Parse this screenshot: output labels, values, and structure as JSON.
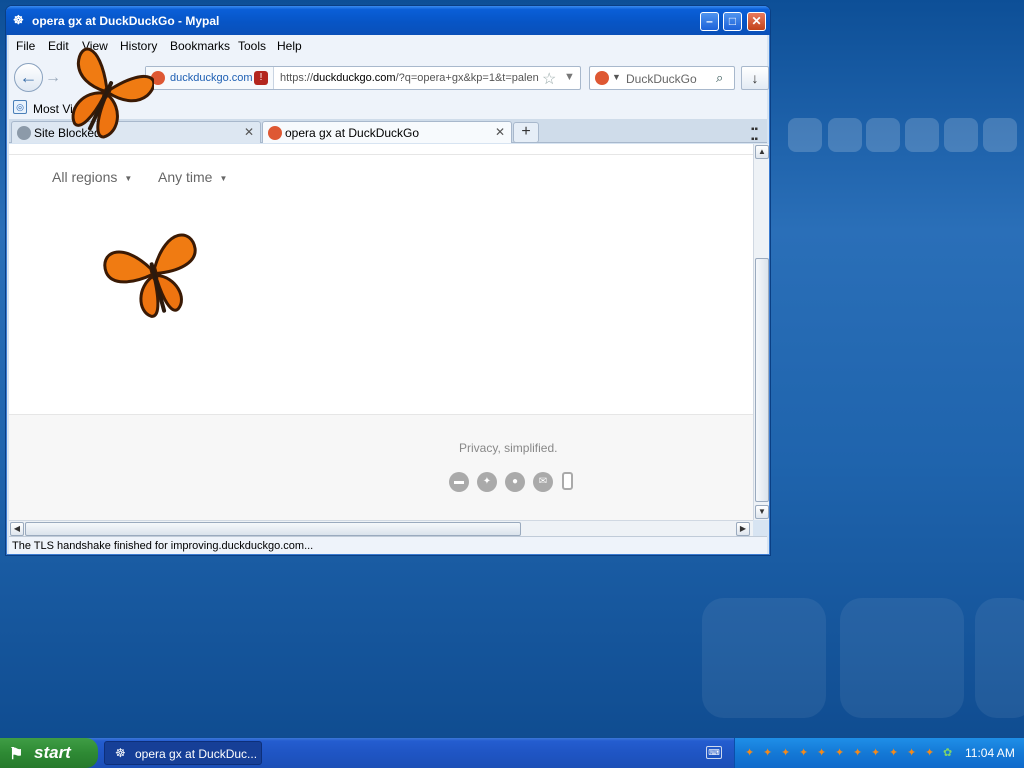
{
  "window": {
    "title": "opera gx at DuckDuckGo - Mypal",
    "controls": {
      "minimize": "–",
      "maximize": "□",
      "close": "✕"
    }
  },
  "menu": [
    "File",
    "Edit",
    "View",
    "History",
    "Bookmarks",
    "Tools",
    "Help"
  ],
  "navbar": {
    "identity_domain": "duckduckgo.com",
    "url_prefix": "https://",
    "url_host": "duckduckgo.com",
    "url_rest": "/?q=opera+gx&kp=1&t=palen",
    "search_engine": "DuckDuckGo"
  },
  "bookmarks": {
    "most_visited": "Most Visited"
  },
  "tabs": [
    {
      "label": "Site Blocked",
      "active": false
    },
    {
      "label": "opera gx at DuckDuckGo",
      "active": true
    }
  ],
  "page": {
    "filters": [
      "All regions",
      "Any time"
    ],
    "tagline": "Privacy, simplified.",
    "social_icons": [
      "chat-icon",
      "twitter-icon",
      "reddit-icon",
      "email-icon",
      "phone-icon"
    ]
  },
  "status": "The TLS handshake finished for improving.duckduckgo.com...",
  "taskbar": {
    "start": "start",
    "task_label": "opera gx at DuckDuc...",
    "clock": "11:04 AM"
  },
  "colors": {
    "accent": "#0755c6",
    "ddg": "#de5833",
    "start_green": "#2e8a34"
  }
}
